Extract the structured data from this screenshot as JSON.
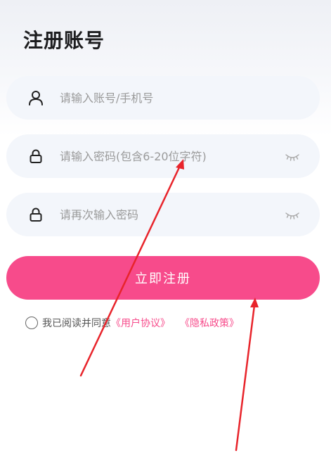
{
  "page": {
    "title": "注册账号"
  },
  "form": {
    "account_placeholder": "请输入账号/手机号",
    "password_placeholder": "请输入密码(包含6-20位字符)",
    "confirm_placeholder": "请再次输入密码",
    "submit_label": "立即注册"
  },
  "agreement": {
    "prefix": "我已阅读并同意",
    "user_agreement": "《用户协议》",
    "privacy_policy": "《隐私政策》"
  },
  "icons": {
    "account": "user-icon",
    "password": "lock-icon",
    "confirm": "lock-icon",
    "toggle": "eye-closed-icon"
  },
  "colors": {
    "accent": "#f74b8b",
    "field_bg": "#f3f6fb",
    "annotation_arrow": "#e8242b"
  }
}
